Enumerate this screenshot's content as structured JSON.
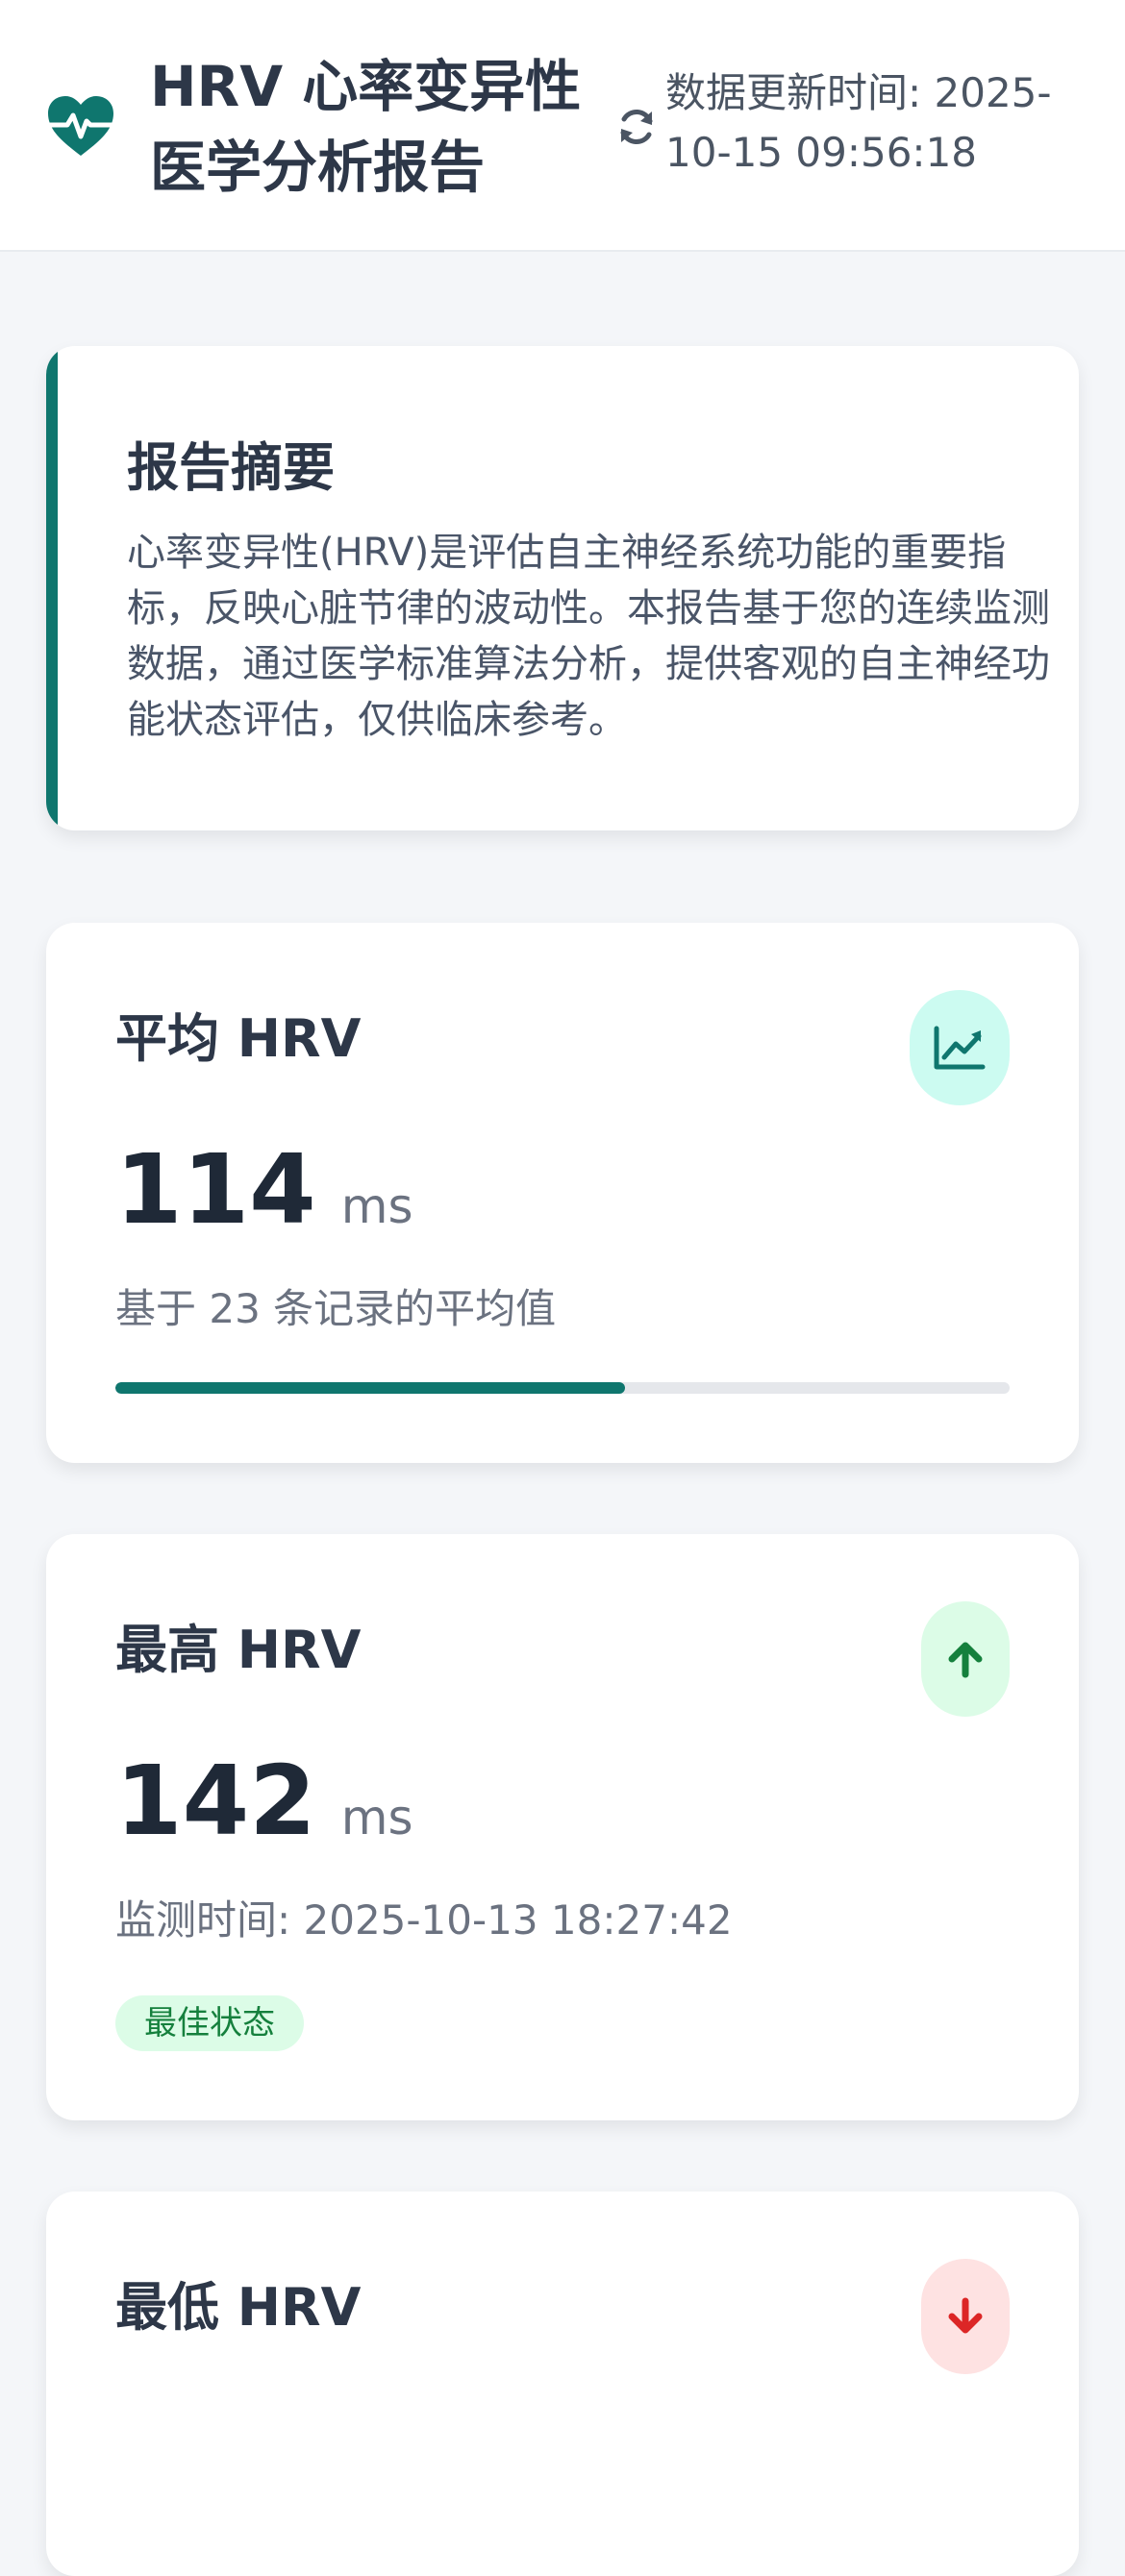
{
  "header": {
    "title": "HRV 心率变异性医学分析报告",
    "brand_icon": "heart-pulse-icon",
    "refresh_icon": "refresh-icon",
    "update_time": "数据更新时间: 2025-10-15 09:56:18"
  },
  "summary": {
    "title": "报告摘要",
    "text": "心率变异性(HRV)是评估自主神经系统功能的重要指标，反映心脏节律的波动性。本报告基于您的连续监测数据，通过医学标准算法分析，提供客观的自主神经功能状态评估，仅供临床参考。"
  },
  "stats": {
    "avg": {
      "title": "平均 HRV",
      "value": "114",
      "unit": "ms",
      "note": "基于 23 条记录的平均值",
      "icon": "chart-line-icon",
      "progress": 0.57
    },
    "max": {
      "title": "最高 HRV",
      "value": "142",
      "unit": "ms",
      "note": "监测时间: 2025-10-13 18:27:42",
      "badge": "最佳状态",
      "icon": "arrow-up-icon"
    },
    "min": {
      "title": "最低 HRV",
      "icon": "arrow-down-icon"
    }
  },
  "colors": {
    "accent": "#0f766e",
    "good": "#15803d",
    "bad": "#dc2626",
    "background": "#f4f6f9"
  }
}
